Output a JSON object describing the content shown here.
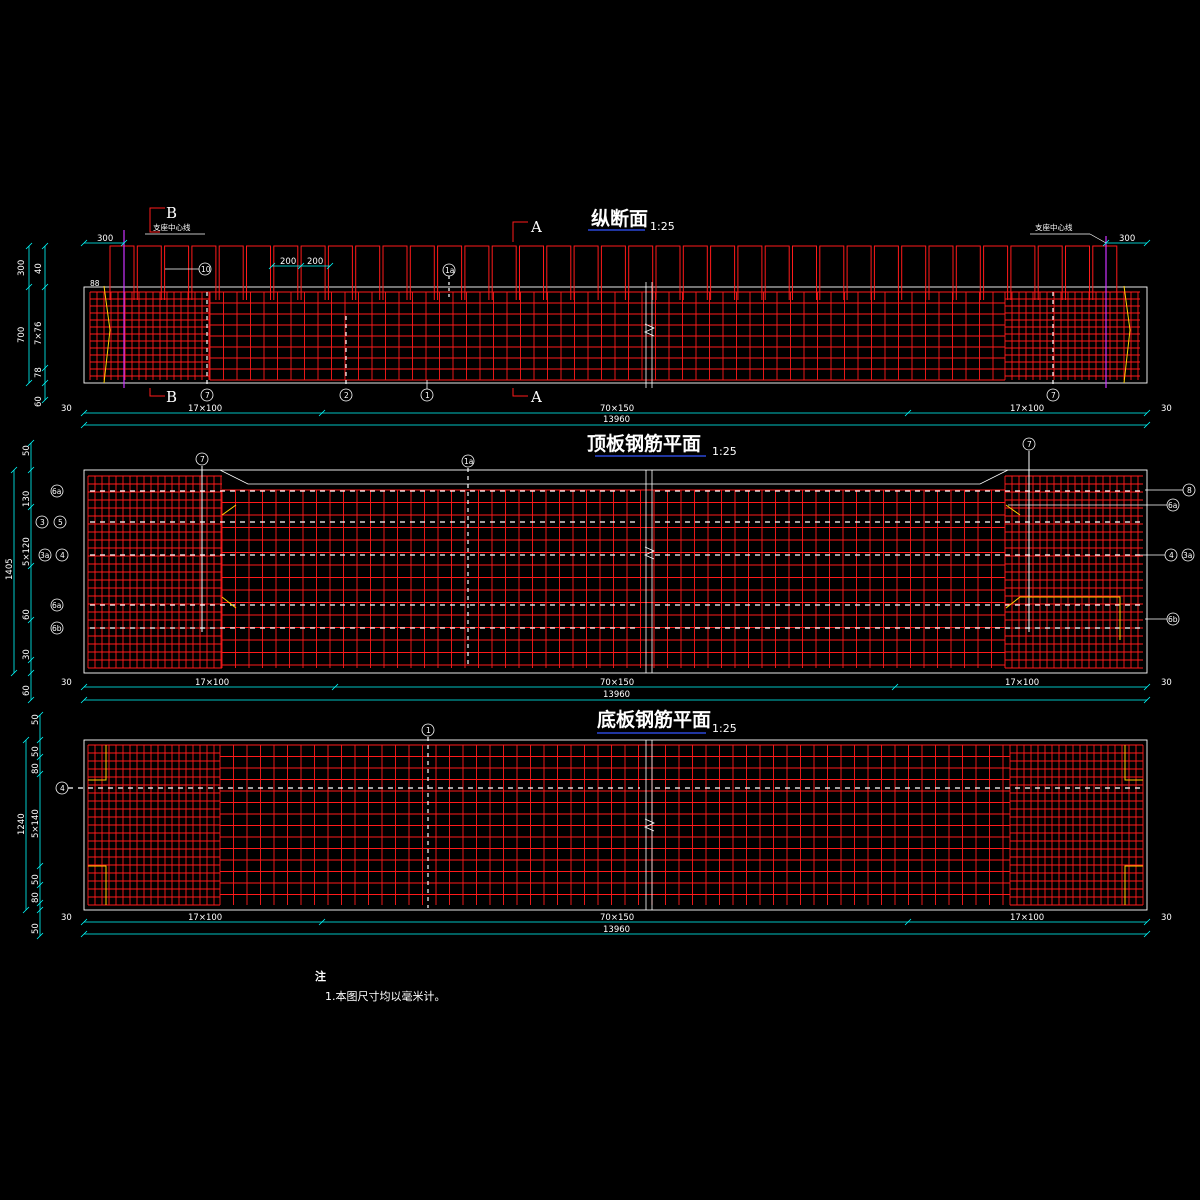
{
  "colors": {
    "background": "#000000",
    "rebar": "#ff1a1a",
    "outline": "#ffffff",
    "dimension": "#00ffff",
    "support": "#cc33ff",
    "accent": "#ffd000",
    "title_underline": "#3355ff"
  },
  "views": {
    "long_section": {
      "title": "纵断面",
      "scale": "1:25",
      "section_b": "B",
      "section_a": "A",
      "support_left": "支座中心线",
      "support_right": "支座中心线",
      "dims_top": [
        "300",
        "200",
        "200",
        "300"
      ],
      "dims_left": [
        "300",
        "40",
        "700",
        "7×76",
        "78",
        "60"
      ],
      "edge_label": "88",
      "dims_bottom": {
        "left_end": "30",
        "seg1": "17×100",
        "seg2": "70×150",
        "seg3": "17×100",
        "right_end": "30",
        "total": "13960"
      },
      "marks": [
        "10",
        "1a",
        "7",
        "2",
        "1",
        "7"
      ]
    },
    "top_plan": {
      "title": "顶板钢筋平面",
      "scale": "1:25",
      "dims_left": [
        "50",
        "1405",
        "130",
        "5×120",
        "60",
        "30",
        "60"
      ],
      "dims_bottom": {
        "left_end": "30",
        "seg1": "17×100",
        "seg2": "70×150",
        "seg3": "17×100",
        "right_end": "30",
        "total": "13960"
      },
      "marks_left": [
        "6a",
        "3",
        "5",
        "3a",
        "4",
        "6a",
        "6b"
      ],
      "marks_right": [
        "8",
        "6a",
        "4",
        "3a",
        "6b"
      ],
      "marks_top": [
        "7",
        "1a",
        "7"
      ]
    },
    "bottom_plan": {
      "title": "底板钢筋平面",
      "scale": "1:25",
      "dims_left": [
        "50",
        "1240",
        "50",
        "80",
        "5×140",
        "50",
        "80",
        "50"
      ],
      "dims_bottom": {
        "left_end": "30",
        "seg1": "17×100",
        "seg2": "70×150",
        "seg3": "17×100",
        "right_end": "30",
        "total": "13960"
      },
      "marks": [
        "1",
        "4"
      ]
    }
  },
  "notes": {
    "heading": "注",
    "items": [
      "1.本图尺寸均以毫米计。"
    ]
  }
}
